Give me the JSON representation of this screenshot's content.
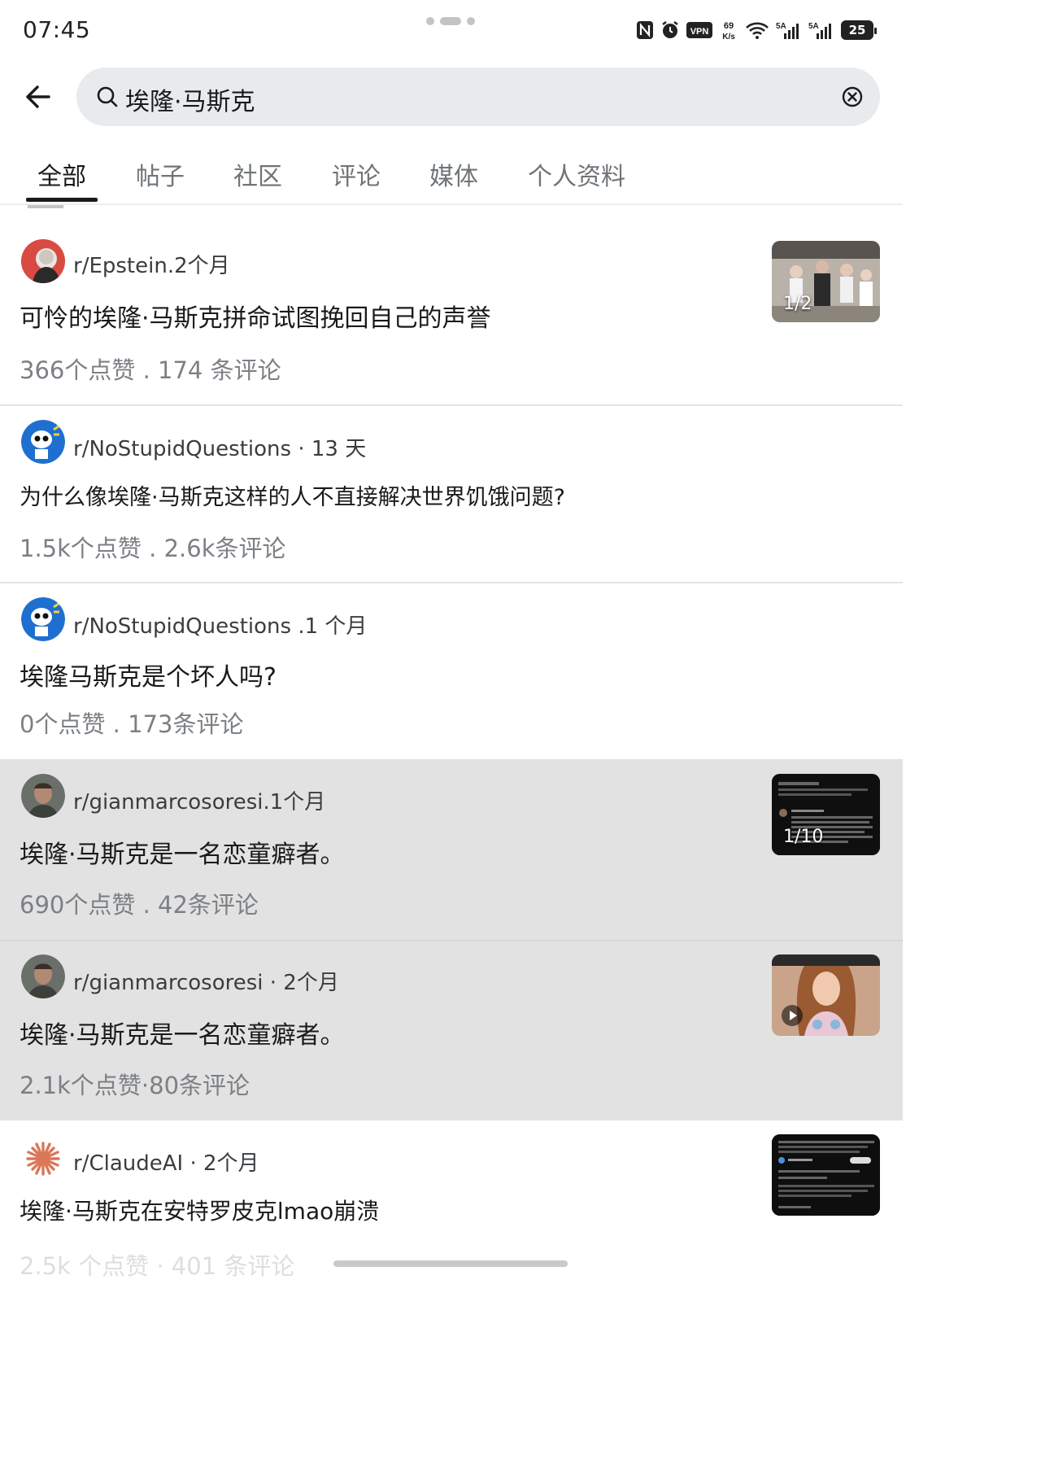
{
  "status_bar": {
    "time": "07:45",
    "speed": "69\nK/s",
    "network_1": "5A",
    "network_2": "5A",
    "battery": "25",
    "icons": [
      "nfc-icon",
      "alarm-icon",
      "vpn-icon",
      "speed-icon",
      "wifi-icon",
      "signal-icon",
      "signal-icon",
      "battery-icon"
    ]
  },
  "search": {
    "query": "埃隆·马斯克",
    "icon": "search-icon",
    "clear_icon": "clear-icon"
  },
  "tabs": [
    {
      "label": "全部",
      "active": true
    },
    {
      "label": "帖子",
      "active": false
    },
    {
      "label": "社区",
      "active": false
    },
    {
      "label": "评论",
      "active": false
    },
    {
      "label": "媒体",
      "active": false
    },
    {
      "label": "个人资料",
      "active": false
    }
  ],
  "posts": [
    {
      "community": "r/Epstein.2个月",
      "title": "可怜的埃隆·马斯克拼命试图挽回自己的声誉",
      "stats": "366个点赞 .  174 条评论",
      "thumb_badge": "1/2"
    },
    {
      "community": "r/NoStupidQuestions · 13 天",
      "title": "为什么像埃隆·马斯克这样的人不直接解决世界饥饿问题?",
      "stats": "1.5k个点赞 . 2.6k条评论"
    },
    {
      "community": "r/NoStupidQuestions .1 个月",
      "title": "埃隆马斯克是个坏人吗?",
      "stats": "0个点赞 . 173条评论"
    },
    {
      "community": "r/gianmarcosoresi.1个月",
      "title": "埃隆·马斯克是一名恋童癖者。",
      "stats": "690个点赞 . 42条评论",
      "thumb_badge": "1/10"
    },
    {
      "community": "r/gianmarcosoresi · 2个月",
      "title": "埃隆·马斯克是一名恋童癖者。",
      "stats": "2.1k个点赞·80条评论"
    },
    {
      "community": "r/ClaudeAI · 2个月",
      "title": "埃隆·马斯克在安特罗皮克lmao崩溃",
      "stats": "2.5k 个点赞 · 401 条评论"
    }
  ],
  "colors": {
    "shaded_row": "#e2e2e2",
    "search_bg": "#e8ebee",
    "meta_gray": "#7c8085",
    "claude_orange": "#d97757"
  }
}
